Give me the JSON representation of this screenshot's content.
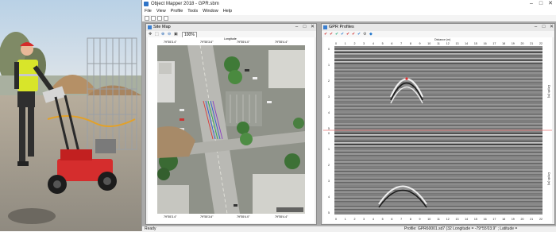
{
  "window": {
    "title": "Object Mapper 2018 - GPR.sbm",
    "minimize": "–",
    "maximize": "□",
    "close": "✕"
  },
  "menu": [
    "File",
    "View",
    "Profile",
    "Tools",
    "Window",
    "Help"
  ],
  "site_map": {
    "title": "Site Map",
    "zoom": "100%",
    "top_axis_label": "Longitude",
    "top_ticks": [
      "79°55'3.4\"",
      "79°55'3.6\"",
      "79°55'4.0\"",
      "79°55'4.4\""
    ],
    "bottom_ticks": [
      "79°55'3.4\"",
      "79°55'3.6\"",
      "79°55'4.0\"",
      "79°55'4.4\""
    ]
  },
  "gpr_profiles": {
    "title": "GPR Profiles",
    "top_axis_label": "Distance (m)",
    "x_ticks": [
      "0",
      "1",
      "2",
      "3",
      "4",
      "5",
      "6",
      "7",
      "8",
      "9",
      "10",
      "11",
      "12",
      "13",
      "14",
      "15",
      "16",
      "17",
      "18",
      "19",
      "20",
      "21",
      "22"
    ],
    "y_ticks": [
      "0",
      "1",
      "2",
      "3",
      "4",
      "5"
    ],
    "side_label": "Depth (m)"
  },
  "status": {
    "left": "Ready",
    "right": "Profile: GPR60001.sd7 (32 Longitude = -79°55'03.9\" ; Latitude ="
  },
  "colors": {
    "accent": "#2e74c8",
    "marker": "#e03030",
    "track_red": "#d93c3c",
    "track_blue": "#2f5fd0",
    "track_green": "#2faa4a"
  }
}
